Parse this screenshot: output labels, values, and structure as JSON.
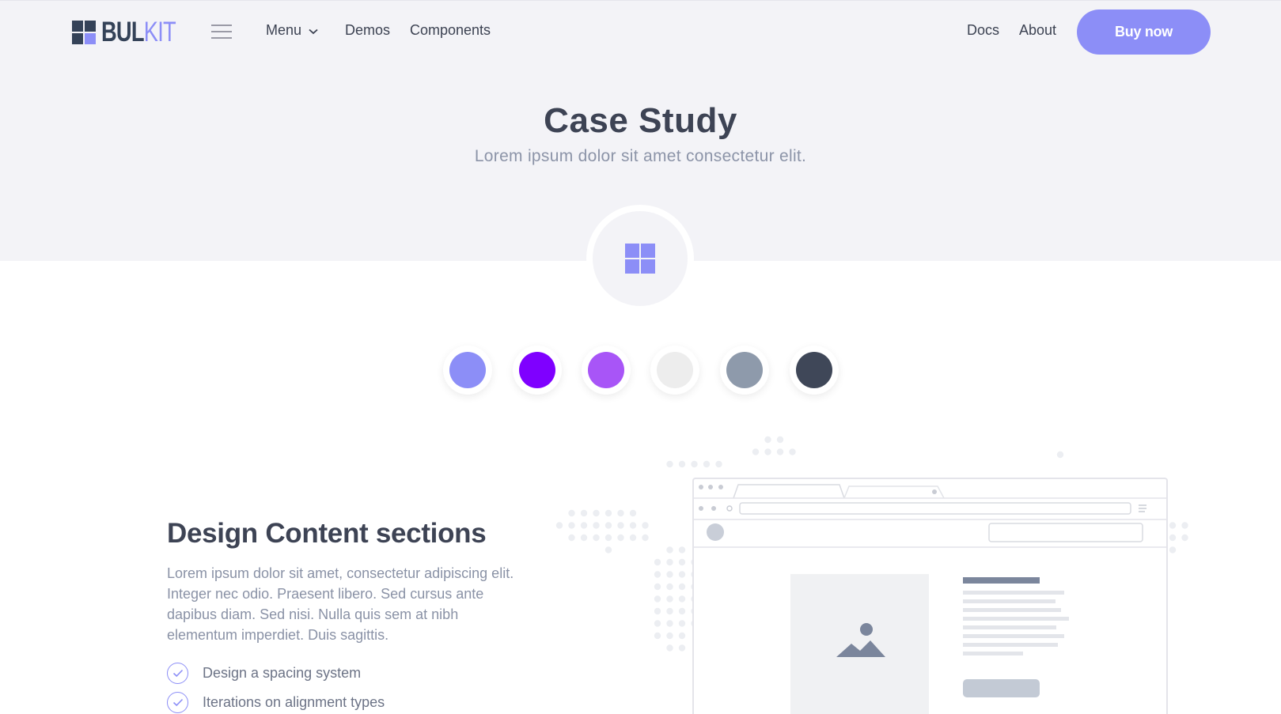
{
  "nav": {
    "logo_part1": "BUL",
    "logo_part2": "KIT",
    "menu_label": "Menu",
    "demos_label": "Demos",
    "components_label": "Components",
    "docs_label": "Docs",
    "about_label": "About",
    "buy_label": "Buy now"
  },
  "hero": {
    "title": "Case Study",
    "subtitle": "Lorem ipsum dolor sit amet consectetur elit."
  },
  "swatches": [
    "#8c8ef7",
    "#7f00ff",
    "#a855f7",
    "#ededed",
    "#8e9aab",
    "#3f4758"
  ],
  "section": {
    "title": "Design Content sections",
    "text": "Lorem ipsum dolor sit amet, consectetur adipiscing elit. Integer nec odio. Praesent libero. Sed cursus ante dapibus diam. Sed nisi. Nulla quis sem at nibh elementum imperdiet. Duis sagittis.",
    "checklist": [
      "Design a spacing system",
      "Iterations on alignment types"
    ]
  },
  "colors": {
    "accent": "#8c8ef7",
    "dark": "#344258",
    "hero_bg": "#f3f3f7"
  }
}
